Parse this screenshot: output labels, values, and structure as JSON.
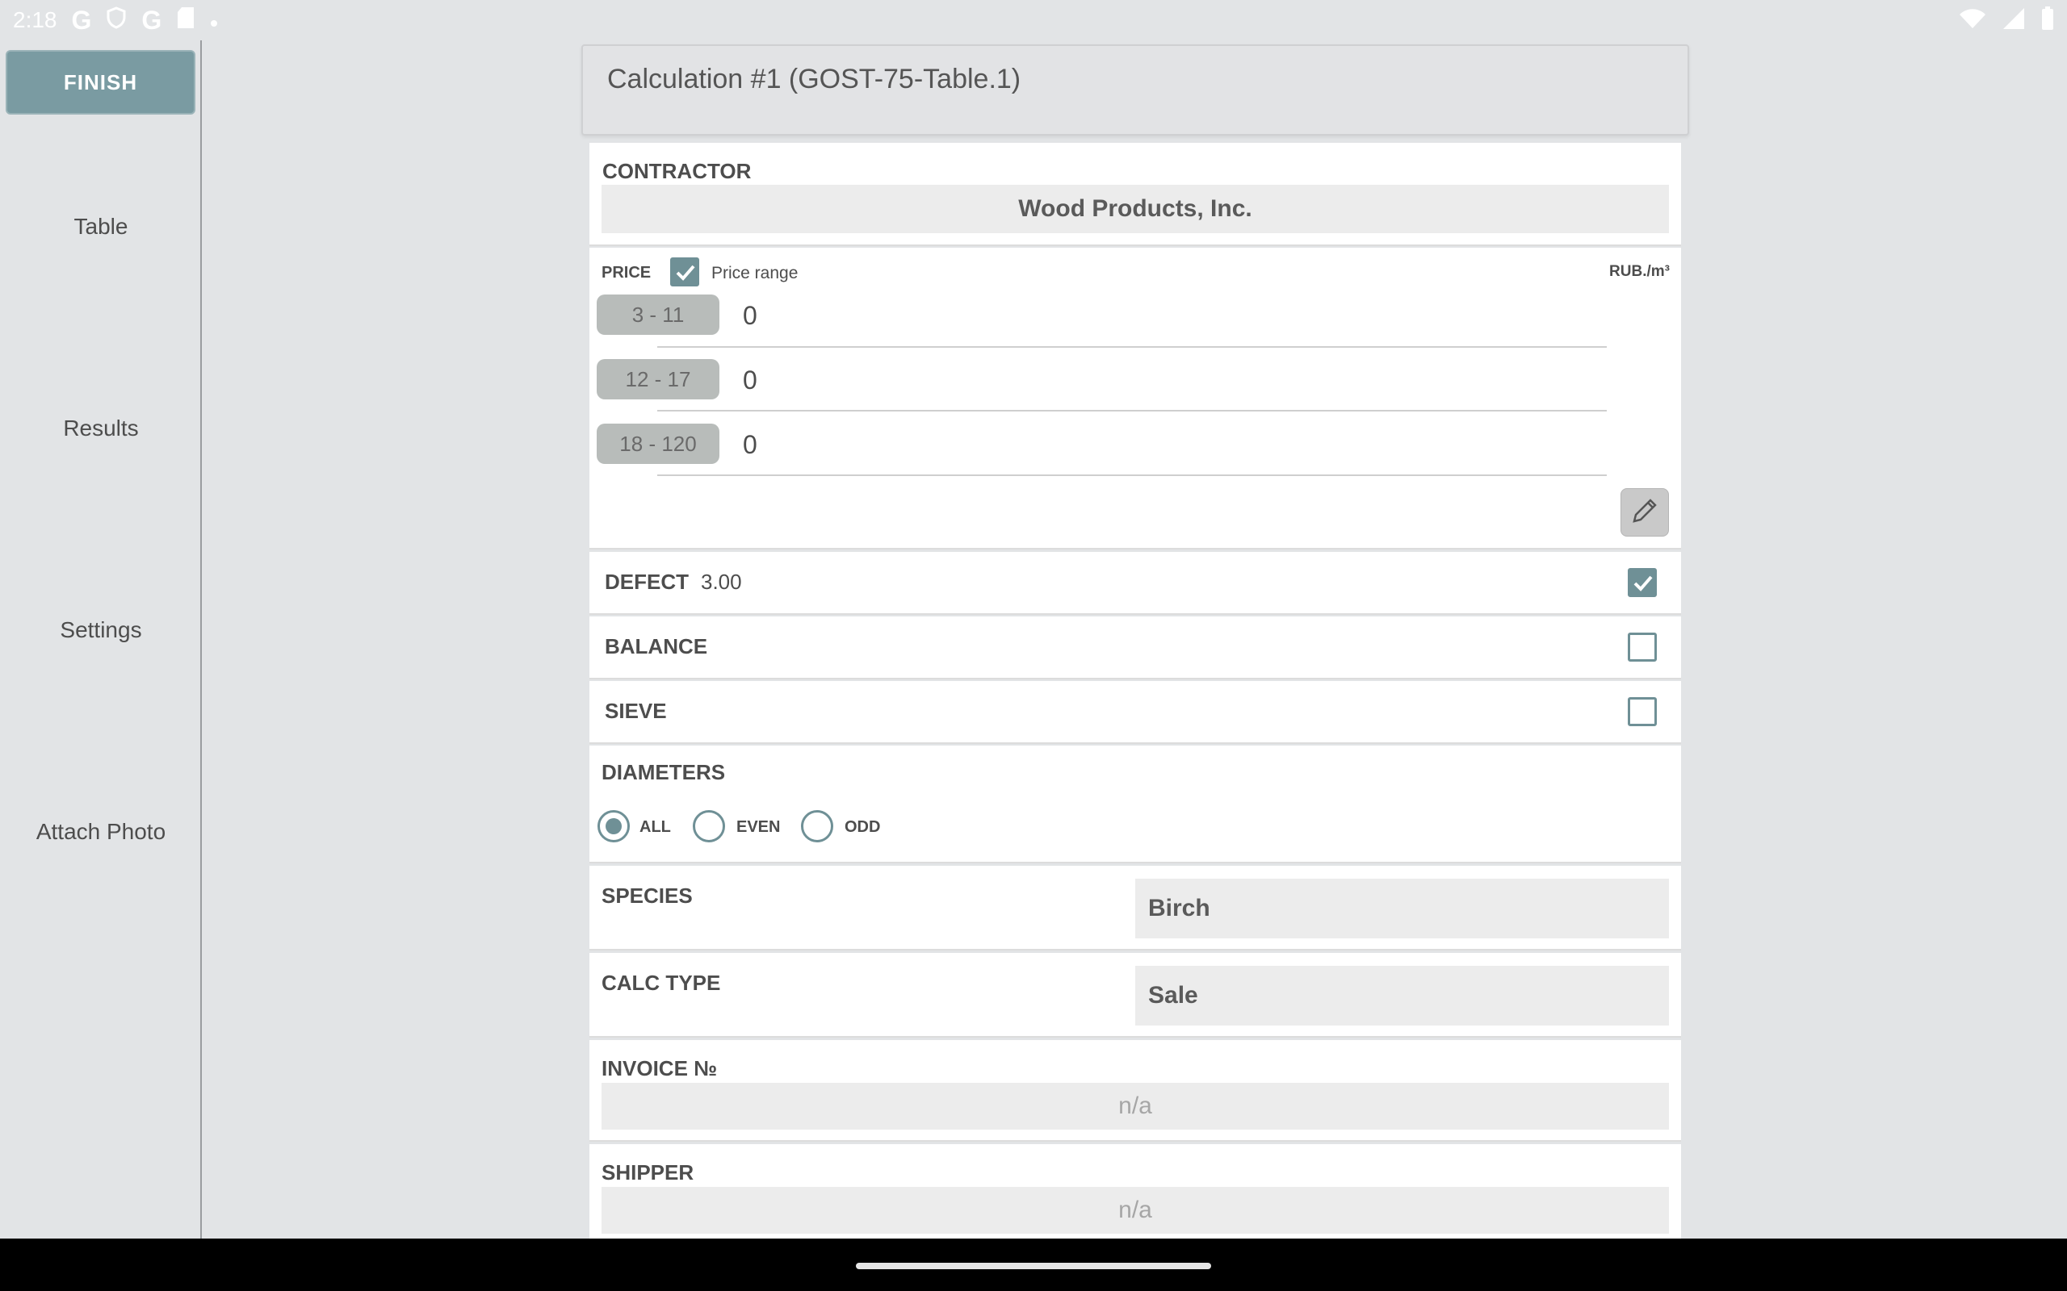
{
  "status_bar": {
    "time": "2:18",
    "left_icons": [
      "google-icon",
      "shield-icon",
      "google-icon",
      "sd-card-icon",
      "dot-icon"
    ],
    "right_icons": [
      "wifi-icon",
      "signal-icon",
      "battery-icon"
    ]
  },
  "sidebar": {
    "finish_label": "FINISH",
    "items": [
      {
        "label": "Table"
      },
      {
        "label": "Results"
      },
      {
        "label": "Settings"
      },
      {
        "label": "Attach Photo"
      }
    ]
  },
  "header": {
    "title": "Calculation #1 (GOST-75-Table.1)"
  },
  "contractor": {
    "label": "CONTRACTOR",
    "value": "Wood Products, Inc."
  },
  "price": {
    "label": "PRICE",
    "range_label": "Price range",
    "range_checked": true,
    "unit": "RUB./m³",
    "rows": [
      {
        "range": "3 - 11",
        "value": "0"
      },
      {
        "range": "12 - 17",
        "value": "0"
      },
      {
        "range": "18 - 120",
        "value": "0"
      }
    ]
  },
  "defect": {
    "label": "DEFECT",
    "value": "3.00",
    "checked": true
  },
  "balance": {
    "label": "BALANCE",
    "checked": false
  },
  "sieve": {
    "label": "SIEVE",
    "checked": false
  },
  "diameters": {
    "label": "DIAMETERS",
    "options": [
      {
        "label": "ALL",
        "selected": true
      },
      {
        "label": "EVEN",
        "selected": false
      },
      {
        "label": "ODD",
        "selected": false
      }
    ]
  },
  "species": {
    "label": "SPECIES",
    "value": "Birch"
  },
  "calc_type": {
    "label": "CALC TYPE",
    "value": "Sale"
  },
  "invoice": {
    "label": "INVOICE №",
    "placeholder": "n/a"
  },
  "shipper": {
    "label": "SHIPPER",
    "placeholder": "n/a"
  },
  "colors": {
    "accent": "#6f9096",
    "finish_button": "#7a9ba2",
    "background": "#e2e4e6"
  }
}
